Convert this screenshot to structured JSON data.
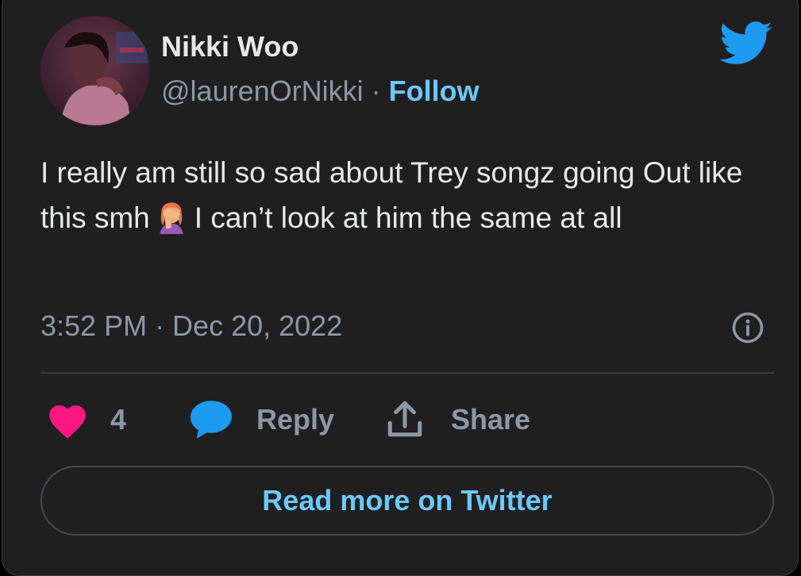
{
  "author": {
    "name": "Nikki Woo",
    "handle": "@laurenOrNikki",
    "separator": "·",
    "follow_label": "Follow"
  },
  "tweet": {
    "text_before_emoji": "I really am still so sad about Trey songz going Out like this smh",
    "emoji": "woman-facepalming-icon",
    "text_after_emoji": "I can’t look at him the same at all",
    "timestamp": "3:52 PM · Dec 20, 2022"
  },
  "actions": {
    "like_count": "4",
    "reply_label": "Reply",
    "share_label": "Share"
  },
  "footer": {
    "read_more_label": "Read more on Twitter"
  },
  "colors": {
    "background": "#1f1f20",
    "text": "#e7e9ea",
    "muted": "#8b98a5",
    "accent": "#6bc9fb",
    "heart": "#f91880",
    "twitter_blue": "#1d9bf0"
  }
}
